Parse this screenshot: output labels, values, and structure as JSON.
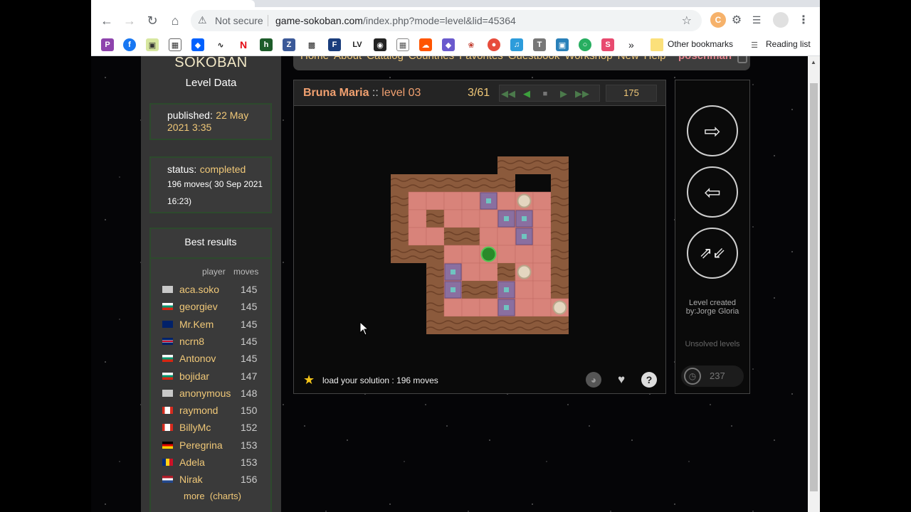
{
  "browser": {
    "security_label": "Not secure",
    "url_host": "game-sokoban.com",
    "url_path": "/index.php?mode=level&lid=45364",
    "bookmarks_overflow": "»",
    "other_bookmarks": "Other bookmarks",
    "reading_list": "Reading list"
  },
  "site": {
    "brand": "SOKOBAN",
    "nav": [
      "Home",
      "About",
      "Catalog",
      "Countries",
      "Favorites",
      "Guestbook",
      "Workshop",
      "New",
      "Help"
    ],
    "username": "poschman"
  },
  "left": {
    "section_title": "Level Data",
    "published_label": "published:",
    "published_value": "22 May 2021 3:35",
    "status_label": "status:",
    "status_value": "completed",
    "status_detail": "196 moves( 30 Sep 2021 16:23)",
    "best_title": "Best results",
    "col_player": "player",
    "col_moves": "moves",
    "results": [
      {
        "player": "aca.soko",
        "moves": "145",
        "flag": "gray"
      },
      {
        "player": "georgiev",
        "moves": "145",
        "flag": "bg"
      },
      {
        "player": "Mr.Kem",
        "moves": "145",
        "flag": "nz"
      },
      {
        "player": "ncrn8",
        "moves": "145",
        "flag": "uk"
      },
      {
        "player": "Antonov",
        "moves": "145",
        "flag": "bg"
      },
      {
        "player": "bojidar",
        "moves": "147",
        "flag": "bg"
      },
      {
        "player": "anonymous",
        "moves": "148",
        "flag": "gray"
      },
      {
        "player": "raymond",
        "moves": "150",
        "flag": "ca"
      },
      {
        "player": "BillyMc",
        "moves": "152",
        "flag": "ca"
      },
      {
        "player": "Peregrina",
        "moves": "153",
        "flag": "de"
      },
      {
        "player": "Adela",
        "moves": "153",
        "flag": "ro"
      },
      {
        "player": "Nirak",
        "moves": "156",
        "flag": "nl"
      }
    ],
    "more_label": "more",
    "charts_label": "(charts)"
  },
  "game": {
    "author": "Bruna Maria",
    "separator": "::",
    "level": "level 03",
    "position": "3/61",
    "moves": "175",
    "solution_text": "load your solution : 196 moves"
  },
  "board": {
    "wall_color": "#8b5a3c",
    "floor_color": "#d8837a",
    "rows": [
      "      ####",
      "#######  #",
      "#    B X #",
      "# #   BG #",
      "#  ##  B #",
      "###  @   #",
      "  #B  #X #",
      "  #G##B  #",
      "  #   G  X",
      "  ########"
    ]
  },
  "right": {
    "created": "Level created by:Jorge Gloria",
    "unsolved": "Unsolved levels",
    "timer_value": "237"
  },
  "colors": {
    "accent": "#f0c878",
    "user": "#e0808a",
    "control_green": "#4b7a4b"
  }
}
